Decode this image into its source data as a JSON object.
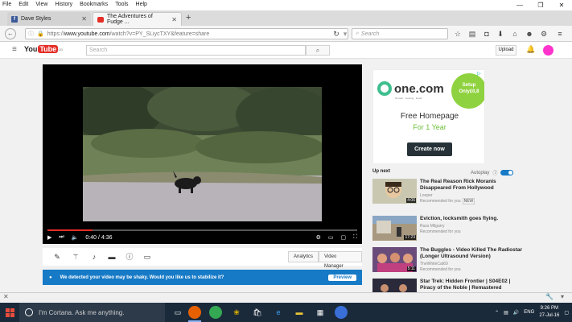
{
  "menubar": {
    "items": [
      "File",
      "Edit",
      "View",
      "History",
      "Bookmarks",
      "Tools",
      "Help"
    ]
  },
  "window_controls": {
    "minimize": "—",
    "restore": "❐",
    "close": "✕"
  },
  "tabs": [
    {
      "title": "Dave Styles",
      "icon": "facebook-icon"
    },
    {
      "title": "The Adventures of Fudge ...",
      "icon": "youtube-icon"
    }
  ],
  "new_tab": "+",
  "url": {
    "prefix": "https://",
    "host": "www.youtube.com",
    "path": "/watch?v=PY_SLiycTXY&feature=share"
  },
  "search_placeholder": "Search",
  "youtube": {
    "logo_you": "You",
    "logo_tube": "Tube",
    "logo_region": "GB",
    "search_placeholder": "Search",
    "upload_label": "Upload"
  },
  "player": {
    "time": "0:40 / 4:36",
    "progress_fraction": 0.145
  },
  "action_bar": {
    "analytics_label": "Analytics",
    "video_manager_label": "Video Manager"
  },
  "stabilize": {
    "message": "We detected your video may be shaky. Would you like us to stabilize it?",
    "preview_label": "Preview"
  },
  "ad": {
    "brand": "one.com",
    "tagline": "Domain · Hosting · Email",
    "burst_line1": "Setup",
    "burst_line2": "Only£0,8",
    "headline": "Free Homepage",
    "subheadline": "For 1 Year",
    "cta": "Create now"
  },
  "sidebar": {
    "upnext_label": "Up next",
    "autoplay_label": "Autoplay",
    "recommendations": [
      {
        "title": "The Real Reason Rick Moranis Disappeared From Hollywood",
        "channel": "Looper",
        "meta": "Recommended for you",
        "badge": "NEW",
        "duration": "4:06"
      },
      {
        "title": "Eviction, locksmith goes flying.",
        "channel": "Russ Milgarry",
        "meta": "Recommended for you",
        "badge": "",
        "duration": "17:23"
      },
      {
        "title": "The Buggles - Video Killed The Radiostar (Longer Ultrasound Version)",
        "channel": "TheWhiteCat69",
        "meta": "Recommended for you",
        "badge": "",
        "duration": "5:11"
      },
      {
        "title": "Star Trek: Hidden Frontier | S04E02 | Piracy of the Noble | Remastered",
        "channel": "",
        "meta": "",
        "badge": "",
        "duration": ""
      }
    ]
  },
  "taskbar": {
    "cortana_placeholder": "I'm Cortana. Ask me anything.",
    "language": "ENG",
    "time": "9:26 PM",
    "date": "27-Jul-16"
  }
}
